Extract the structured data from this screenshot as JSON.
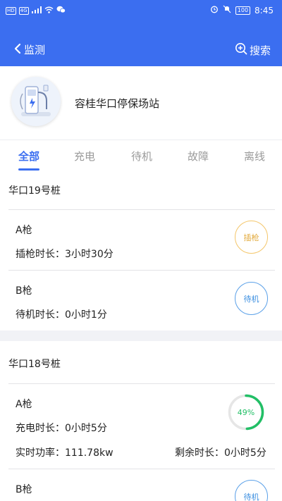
{
  "status_bar": {
    "left_chips": [
      "HD",
      "4G"
    ],
    "time": "8:45",
    "battery": "100"
  },
  "nav": {
    "back_label": "监测",
    "search_label": "搜索"
  },
  "station": {
    "name": "容桂华口停保场站"
  },
  "tabs": [
    {
      "label": "全部",
      "active": true
    },
    {
      "label": "充电",
      "active": false
    },
    {
      "label": "待机",
      "active": false
    },
    {
      "label": "故障",
      "active": false
    },
    {
      "label": "离线",
      "active": false
    }
  ],
  "piles": [
    {
      "title": "华口19号桩",
      "guns": [
        {
          "name": "A枪",
          "line1": "插枪时长：3小时30分",
          "status": "插枪"
        },
        {
          "name": "B枪",
          "line1": "待机时长：0小时1分",
          "status": "待机"
        }
      ]
    },
    {
      "title": "华口18号桩",
      "guns": [
        {
          "name": "A枪",
          "line1": "充电时长：0小时5分",
          "line2_left": "实时功率：111.78kw",
          "line2_right": "剩余时长：0小时5分",
          "status": "49%",
          "progress": 0.49
        },
        {
          "name": "B枪",
          "status": "待机"
        }
      ]
    }
  ],
  "colors": {
    "primary": "#3b6ef0",
    "plug": "#e2a93a",
    "idle": "#3a8ee0",
    "charging": "#22bf66"
  }
}
